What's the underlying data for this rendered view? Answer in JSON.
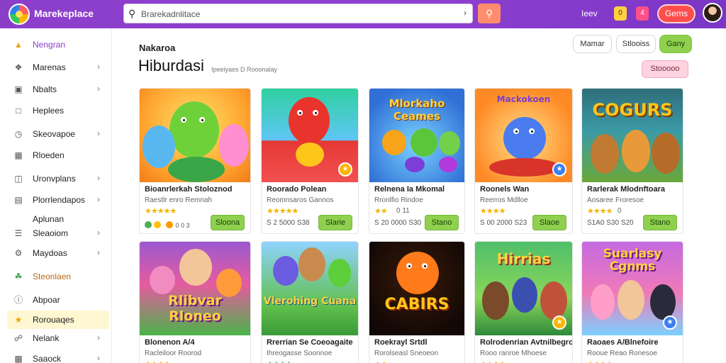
{
  "header": {
    "brand": "Marekeplace",
    "search_value": "Brarekadnlitace",
    "link": "Ieev",
    "badge_1": "0",
    "badge_2": "4",
    "games_button": "Gems"
  },
  "sidebar": {
    "items": [
      {
        "label": "Nengran",
        "icon": "home-icon",
        "arrow": false
      },
      {
        "label": "Marenas",
        "icon": "tag-icon",
        "arrow": true
      },
      {
        "label": "Nbalts",
        "icon": "book-icon",
        "arrow": true
      },
      {
        "label": "Heplees",
        "icon": "bookmark-icon",
        "arrow": false
      },
      {
        "label": "Skeovapoe",
        "icon": "clock-icon",
        "arrow": true
      },
      {
        "label": "Rloeden",
        "icon": "grid-icon",
        "arrow": false
      },
      {
        "label": "Uronvplans",
        "icon": "layers-icon",
        "arrow": true
      },
      {
        "label": "Plorrlendapos",
        "icon": "folder-icon",
        "arrow": true
      },
      {
        "label": "Aplunan",
        "icon": "",
        "arrow": false
      },
      {
        "label": "Sleaoiom",
        "icon": "list-icon",
        "arrow": true
      },
      {
        "label": "Maydoas",
        "icon": "settings-icon",
        "arrow": true
      },
      {
        "label": "Steonlaen",
        "icon": "leaf-icon",
        "arrow": false
      },
      {
        "label": "Abpoar",
        "icon": "info-icon",
        "arrow": false
      },
      {
        "label": "Rorouaqes",
        "icon": "star-icon",
        "arrow": false
      },
      {
        "label": "Nelank",
        "icon": "link-icon",
        "arrow": true
      },
      {
        "label": "Saaock",
        "icon": "chart-icon",
        "arrow": true
      }
    ]
  },
  "main": {
    "kicker": "Nakaroa",
    "title": "Hiburdasi",
    "subtitle": "Ipeeiyaes D Rooonalay",
    "filters": [
      "Mamar",
      "Stlooiss",
      "Gany"
    ],
    "sort_button": "Stooooo"
  },
  "cards": [
    {
      "title": "Bioanrlerkah Stoloznod",
      "dev": "Raestlr enro Remnah",
      "stars": "★★★★★",
      "rating": "",
      "meta": "0 0 3",
      "price_label": "Sloona",
      "art_label": "",
      "badge": true
    },
    {
      "title": "Roorado Polean",
      "dev": "Reomnsaros Gannos",
      "stars": "★★★★★",
      "rating": "",
      "meta": "S 2 5000 S38",
      "price_label": "Slarie",
      "art_label": "",
      "badge": true
    },
    {
      "title": "Relnena Ia Mkomal",
      "dev": "Rronlfio Rindoe",
      "stars": "★★",
      "rating": "0 11",
      "meta": "S 20 0000 S30",
      "price_label": "Stano",
      "art_label": "Mlorkaho Ceames",
      "badge": false
    },
    {
      "title": "Roonels Wan",
      "dev": "Reerros Mdlloe",
      "stars": "★★★★",
      "rating": "",
      "meta": "S 00 2000 S23",
      "price_label": "Slaoe",
      "art_label": "Mackokoen",
      "badge": true
    },
    {
      "title": "Rarlerak Mlodnftoara",
      "dev": "Aosaree Froresoe",
      "stars": "★★★★",
      "rating": "0",
      "meta": "S1A0 S30 S20",
      "price_label": "Stano",
      "art_label": "COGURS",
      "badge": false
    },
    {
      "title": "Blonenon A/4",
      "dev": "Racleiloor Roorod",
      "stars": "★★★★",
      "rating": "",
      "meta": "",
      "price_label": "",
      "art_label": "Rlibvar Rloneo",
      "badge": false
    },
    {
      "title": "Rrerrian Se Coeoagaite",
      "dev": "Ihreogasse Soonnoe",
      "stars": "★★★★",
      "rating": "",
      "meta": "",
      "price_label": "",
      "art_label": "Vlerohing Cuana",
      "badge": false
    },
    {
      "title": "Roekrayl Srtdl",
      "dev": "Rorolseasl Sneoeon",
      "stars": "★★",
      "rating": "",
      "meta": "",
      "price_label": "",
      "art_label": "CABIRS",
      "badge": false
    },
    {
      "title": "Rolrodenrian Avtnilbegro",
      "dev": "Rooo ranroe Mhoese",
      "stars": "★★★★",
      "rating": "",
      "meta": "",
      "price_label": "",
      "art_label": "Hirrias",
      "badge": true
    },
    {
      "title": "Raoaes A/Blnefoire",
      "dev": "Rooue Reao Ronesoe",
      "stars": "★★★★",
      "rating": "",
      "meta": "",
      "price_label": "",
      "art_label": "Suarlasy Cgnms",
      "badge": true
    }
  ],
  "colors": {
    "topbar": "#8b3fc9",
    "accent_green": "#8fd14f",
    "accent_red": "#ff4d4d",
    "sort_pink": "#ffd3e0"
  }
}
